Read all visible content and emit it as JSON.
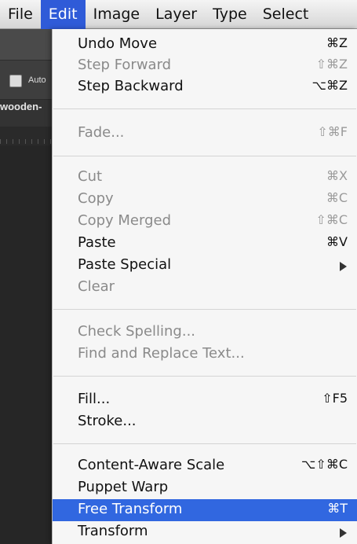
{
  "menubar": {
    "items": [
      "File",
      "Edit",
      "Image",
      "Layer",
      "Type",
      "Select"
    ],
    "active": "Edit"
  },
  "background": {
    "auto_label": "Auto",
    "document_tab": "wooden-"
  },
  "colors": {
    "highlight": "#3167e0",
    "menu_active": "#2f5bd8",
    "disabled_text": "#8a8a8a"
  },
  "edit_menu": {
    "undo_move": {
      "label": "Undo Move",
      "shortcut": "⌘Z"
    },
    "step_forward": {
      "label": "Step Forward",
      "shortcut": "⇧⌘Z"
    },
    "step_backward": {
      "label": "Step Backward",
      "shortcut": "⌥⌘Z"
    },
    "fade": {
      "label": "Fade...",
      "shortcut": "⇧⌘F"
    },
    "cut": {
      "label": "Cut",
      "shortcut": "⌘X"
    },
    "copy": {
      "label": "Copy",
      "shortcut": "⌘C"
    },
    "copy_merged": {
      "label": "Copy Merged",
      "shortcut": "⇧⌘C"
    },
    "paste": {
      "label": "Paste",
      "shortcut": "⌘V"
    },
    "paste_special": {
      "label": "Paste Special"
    },
    "clear": {
      "label": "Clear"
    },
    "check_spelling": {
      "label": "Check Spelling..."
    },
    "find_replace": {
      "label": "Find and Replace Text..."
    },
    "fill": {
      "label": "Fill...",
      "shortcut": "⇧F5"
    },
    "stroke": {
      "label": "Stroke..."
    },
    "content_aware_scale": {
      "label": "Content-Aware Scale",
      "shortcut": "⌥⇧⌘C"
    },
    "puppet_warp": {
      "label": "Puppet Warp"
    },
    "free_transform": {
      "label": "Free Transform",
      "shortcut": "⌘T"
    },
    "transform": {
      "label": "Transform"
    }
  }
}
